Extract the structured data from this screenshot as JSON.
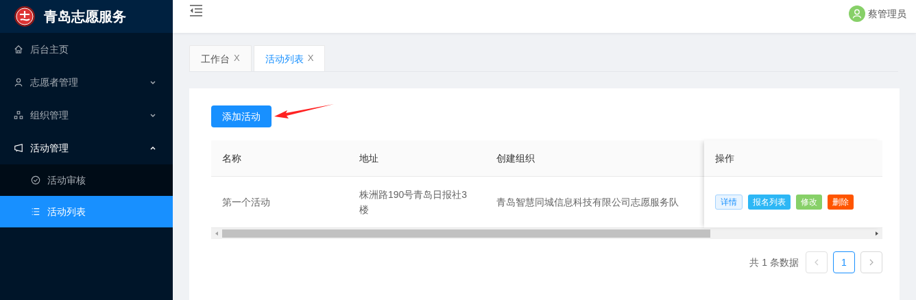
{
  "sidebar": {
    "title": "青岛志愿服务",
    "items": [
      {
        "label": "后台主页",
        "selected": false
      },
      {
        "label": "志愿者管理",
        "selected": false,
        "expanded": false
      },
      {
        "label": "组织管理",
        "selected": false,
        "expanded": false
      },
      {
        "label": "活动管理",
        "selected": true,
        "expanded": true,
        "children": [
          {
            "label": "活动审核",
            "selected": false
          },
          {
            "label": "活动列表",
            "selected": true
          }
        ]
      }
    ]
  },
  "header": {
    "user": "蔡管理员"
  },
  "tabs": [
    {
      "label": "工作台",
      "close": "X",
      "selected": false
    },
    {
      "label": "活动列表",
      "close": "X",
      "selected": true
    }
  ],
  "add_button": "添加活动",
  "table": {
    "columns": [
      "名称",
      "地址",
      "创建组织"
    ],
    "action_column": "操作",
    "rows": [
      {
        "cells": [
          "第一个活动",
          "株洲路190号青岛日报社3楼",
          "青岛智慧同城信息科技有限公司志愿服务队"
        ],
        "actions": [
          {
            "label": "详情",
            "kind": "outline",
            "color": "#1890ff"
          },
          {
            "label": "报名列表",
            "kind": "solid",
            "color": "#2db7f5"
          },
          {
            "label": "修改",
            "kind": "solid",
            "color": "#87d068"
          },
          {
            "label": "删除",
            "kind": "solid",
            "color": "#ff5500"
          }
        ]
      }
    ]
  },
  "pagination": {
    "total": "共 1 条数据",
    "pages": [
      {
        "label": "1",
        "selected": true
      }
    ],
    "prev_disabled": true,
    "next_disabled": false
  }
}
